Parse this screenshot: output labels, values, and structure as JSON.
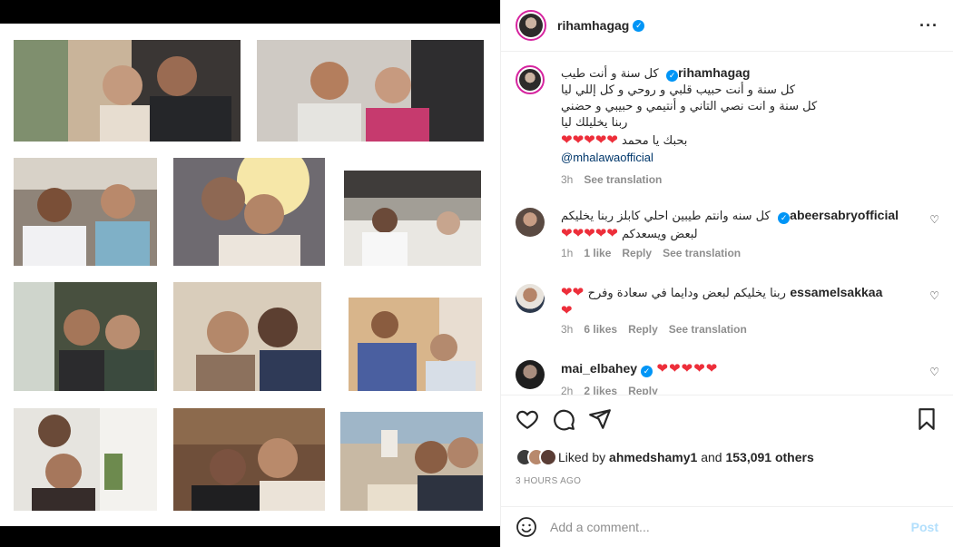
{
  "post": {
    "author": "rihamhagag",
    "caption_lines": [
      "كل سنة و أنت طيب",
      "كل سنة و أنت حبيب قلبي و روحي و كل إللي ليا",
      "كل سنة و انت نصي التاني و أنتيمي و حبيبي و حضني",
      "ربنا يخليلك ليا",
      "بحبك يا محمد"
    ],
    "caption_hearts": "❤❤❤❤❤",
    "mention": "@mhalawaofficial",
    "caption_time": "3h",
    "see_translation": "See translation"
  },
  "comments": [
    {
      "user": "abeersabryofficial",
      "text_line1": "كل سنه وانتم طيبين احلي كابلز ربنا يخليكم",
      "text_line2": "لبعض ويسعدكم",
      "hearts": "❤❤❤❤❤",
      "time": "1h",
      "likes": "1 like",
      "reply": "Reply",
      "translate": "See translation"
    },
    {
      "user": "essamelsakkaa",
      "text_line1": "ربنا يخليكم لبعض ودايما في سعادة وفرح",
      "hearts_inline": "❤❤",
      "hearts": "❤",
      "time": "3h",
      "likes": "6 likes",
      "reply": "Reply",
      "translate": "See translation"
    },
    {
      "user": "mai_elbahey",
      "hearts": "❤❤❤❤❤",
      "time": "2h",
      "likes": "2 likes",
      "reply": "Reply"
    }
  ],
  "likes": {
    "prefix": "Liked by",
    "user": "ahmedshamy1",
    "and": "and",
    "others": "153,091 others"
  },
  "timestamp": "3 HOURS AGO",
  "add_comment": {
    "placeholder": "Add a comment...",
    "post_label": "Post"
  },
  "colors": {
    "verified": "#0095f6",
    "heart": "#ed2e3a",
    "mention": "#00376b",
    "post_disabled": "#b2dffc"
  }
}
